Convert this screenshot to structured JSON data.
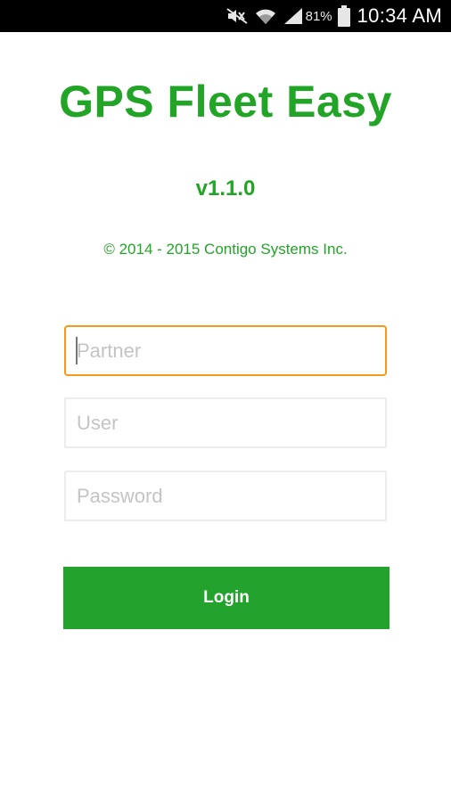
{
  "status_bar": {
    "icons": [
      "mute-icon",
      "wifi-icon",
      "cell-signal-icon",
      "battery-icon"
    ],
    "battery_percent": "81%",
    "time": "10:34 AM"
  },
  "app": {
    "title": "GPS Fleet Easy",
    "version": "v1.1.0",
    "copyright": "© 2014 - 2015 Contigo Systems Inc."
  },
  "form": {
    "partner_placeholder": "Partner",
    "user_placeholder": "User",
    "password_placeholder": "Password",
    "login_label": "Login"
  },
  "colors": {
    "brand_green": "#22a527",
    "focus_orange": "#f29a1c",
    "status_bar_bg": "#000000"
  }
}
